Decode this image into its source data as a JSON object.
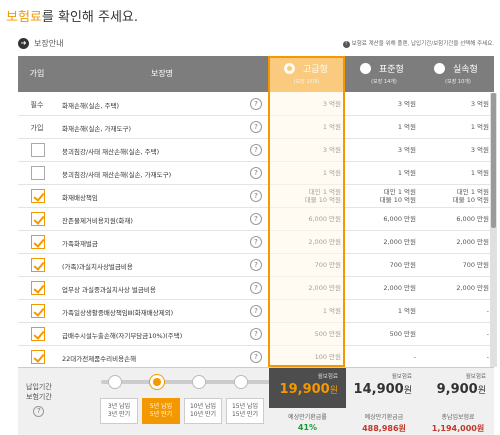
{
  "header": {
    "title_highlight": "보험료",
    "title_rest": "를 확인해 주세요.",
    "intro_label": "보장안내",
    "note": "보험료 계산을 위해 플랜, 납입기간/보험기간을 선택해 주세요."
  },
  "table": {
    "col_join": "가입",
    "col_coverage": "보장명",
    "plans": [
      {
        "name": "고급형",
        "sub": "(보장 16개)",
        "selected": true
      },
      {
        "name": "표준형",
        "sub": "(보장 14개)",
        "selected": false
      },
      {
        "name": "실속형",
        "sub": "(보장 10개)",
        "selected": false
      }
    ],
    "rows": [
      {
        "join": "필수",
        "checkbox": null,
        "name": "화재손해(실손, 주택)",
        "v1": "3 억원",
        "v2": "3 억원",
        "v3": "3 억원"
      },
      {
        "join": "가입",
        "checkbox": null,
        "name": "화재손해(실손, 가재도구)",
        "v1": "1 억원",
        "v2": "1 억원",
        "v3": "1 억원"
      },
      {
        "join": "",
        "checkbox": false,
        "name": "붕괴침강/사태 재산손해(실손, 주택)",
        "v1": "3 억원",
        "v2": "3 억원",
        "v3": "3 억원"
      },
      {
        "join": "",
        "checkbox": false,
        "name": "붕괴침강/사태 재산손해(실손, 가재도구)",
        "v1": "1 억원",
        "v2": "1 억원",
        "v3": "1 억원"
      },
      {
        "join": "",
        "checkbox": true,
        "name": "화재배상책임",
        "v1": "대인 1 억원\n대물 10 억원",
        "v2": "대인 1 억원\n대물 10 억원",
        "v3": "대인 1 억원\n대물 10 억원"
      },
      {
        "join": "",
        "checkbox": true,
        "name": "잔존물제거비용지원(화재)",
        "v1": "6,000 만원",
        "v2": "6,000 만원",
        "v3": "6,000 만원"
      },
      {
        "join": "",
        "checkbox": true,
        "name": "가족화재벌금",
        "v1": "2,000 만원",
        "v2": "2,000 만원",
        "v3": "2,000 만원"
      },
      {
        "join": "",
        "checkbox": true,
        "name": "(가족)과실치사상벌금비용",
        "v1": "700 만원",
        "v2": "700 만원",
        "v3": "700 만원"
      },
      {
        "join": "",
        "checkbox": true,
        "name": "업무상 과실중과실치사상 벌금비용",
        "v1": "2,000 만원",
        "v2": "2,000 만원",
        "v3": "2,000 만원"
      },
      {
        "join": "",
        "checkbox": true,
        "name": "가족일상생활중배상책임Ⅲ(화재배상제외)",
        "v1": "1 억원",
        "v2": "1 억원",
        "v3": "-"
      },
      {
        "join": "",
        "checkbox": true,
        "name": "급배수시설누출손해(자기부담금10%)(주택)",
        "v1": "500 만원",
        "v2": "500 만원",
        "v3": "-"
      },
      {
        "join": "",
        "checkbox": true,
        "name": "22대가전제품수리비용손해",
        "v1": "100 만원",
        "v2": "-",
        "v3": "-"
      }
    ]
  },
  "footer": {
    "period_label": "납입기간\n보험기간",
    "options": [
      {
        "label": "3년 납입\n3년 만기",
        "selected": false
      },
      {
        "label": "5년 납입\n5년 만기",
        "selected": true
      },
      {
        "label": "10년 납입\n10년 만기",
        "selected": false
      },
      {
        "label": "15년 납입\n15년 만기",
        "selected": false
      }
    ],
    "premiums": [
      {
        "label": "월보험료",
        "amount": "19,900",
        "unit": "원"
      },
      {
        "label": "월보험료",
        "amount": "14,900",
        "unit": "원"
      },
      {
        "label": "월보험료",
        "amount": "9,900",
        "unit": "원"
      }
    ],
    "extras": [
      {
        "label": "예상만기환급률",
        "value": "41%"
      },
      {
        "label": "예상만기환급금",
        "value": "488,986원"
      },
      {
        "label": "총납입보험료",
        "value": "1,194,000원"
      }
    ]
  },
  "colors": {
    "accent": "#f39800",
    "header_bg": "#7d7d7d",
    "dark_premium": "#4d4d4d",
    "green": "#1c9a34",
    "red": "#c0392b"
  }
}
